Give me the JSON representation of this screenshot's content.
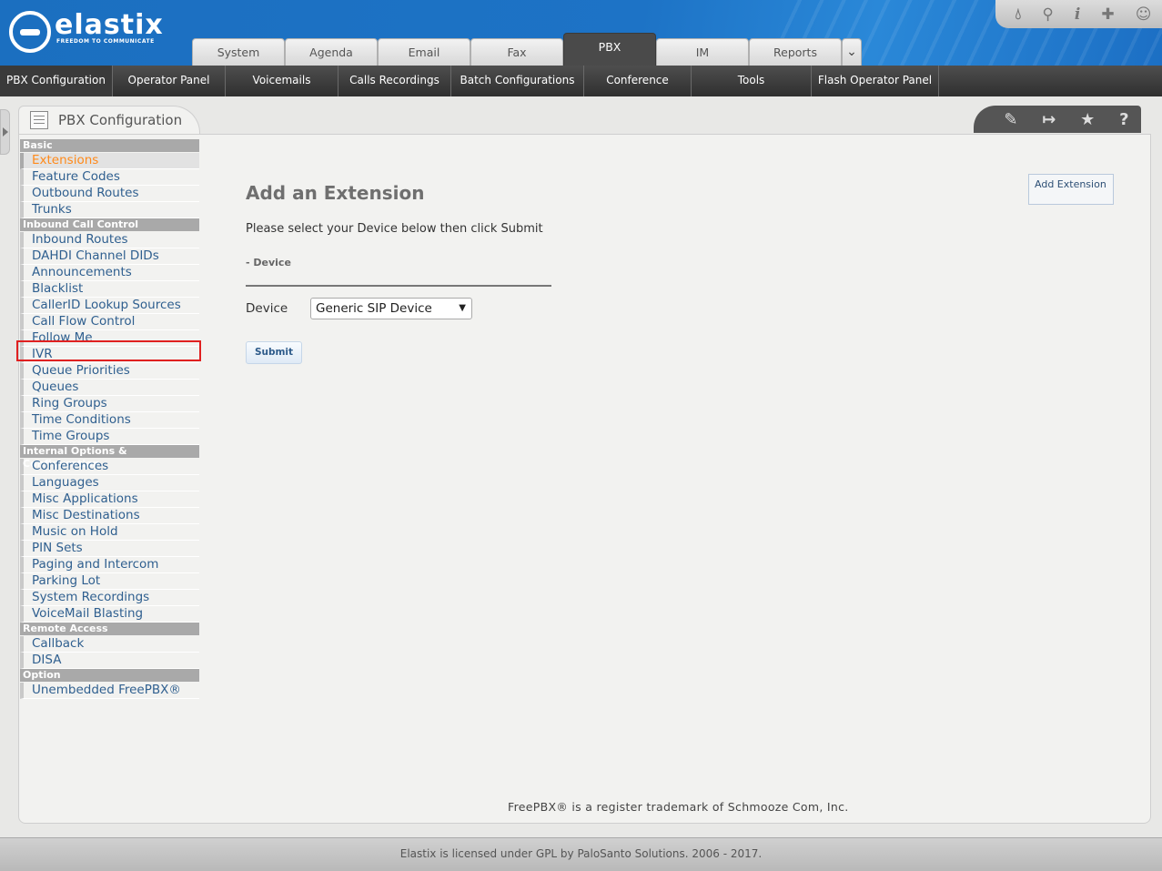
{
  "app": {
    "logo_text": "elastix",
    "logo_tagline": "FREEDOM TO COMMUNICATE"
  },
  "header_tools": [
    "droplet-icon",
    "search-icon",
    "info-icon",
    "puzzle-icon",
    "user-icon"
  ],
  "top_tabs": [
    {
      "label": "System"
    },
    {
      "label": "Agenda"
    },
    {
      "label": "Email"
    },
    {
      "label": "Fax"
    },
    {
      "label": "PBX",
      "active": true
    },
    {
      "label": "IM"
    },
    {
      "label": "Reports"
    }
  ],
  "sub_menu": [
    {
      "label": "PBX Configuration",
      "active": true
    },
    {
      "label": "Operator Panel"
    },
    {
      "label": "Voicemails"
    },
    {
      "label": "Calls Recordings"
    },
    {
      "label": "Batch Configurations"
    },
    {
      "label": "Conference"
    },
    {
      "label": "Tools"
    },
    {
      "label": "Flash Operator Panel"
    }
  ],
  "panel": {
    "title": "PBX Configuration",
    "tools": [
      "edit-icon",
      "logout-icon",
      "star-icon",
      "help-icon"
    ]
  },
  "sidebar": [
    {
      "header": "Basic",
      "items": [
        "Extensions",
        "Feature Codes",
        "Outbound Routes",
        "Trunks"
      ]
    },
    {
      "header": "Inbound Call Control",
      "items": [
        "Inbound Routes",
        "DAHDI Channel DIDs",
        "Announcements",
        "Blacklist",
        "CallerID Lookup Sources",
        "Call Flow Control",
        "Follow Me",
        "IVR",
        "Queue Priorities",
        "Queues",
        "Ring Groups",
        "Time Conditions",
        "Time Groups"
      ]
    },
    {
      "header": "Internal Options & Configuration",
      "items": [
        "Conferences",
        "Languages",
        "Misc Applications",
        "Misc Destinations",
        "Music on Hold",
        "PIN Sets",
        "Paging and Intercom",
        "Parking Lot",
        "System Recordings",
        "VoiceMail Blasting"
      ]
    },
    {
      "header": "Remote Access",
      "items": [
        "Callback",
        "DISA"
      ]
    },
    {
      "header": "Option",
      "items": [
        "Unembedded FreePBX®"
      ]
    }
  ],
  "sidebar_current": "Extensions",
  "sidebar_highlight": "Follow Me",
  "main": {
    "title": "Add an Extension",
    "instruction": "Please select your Device below then click Submit",
    "section": "- Device",
    "device_label": "Device",
    "device_value": "Generic SIP Device",
    "submit_label": "Submit",
    "add_extension_link": "Add Extension",
    "trademark": "FreePBX® is a register trademark of Schmooze Com, Inc."
  },
  "footer": "Elastix is licensed under GPL by PaloSanto Solutions. 2006 - 2017."
}
